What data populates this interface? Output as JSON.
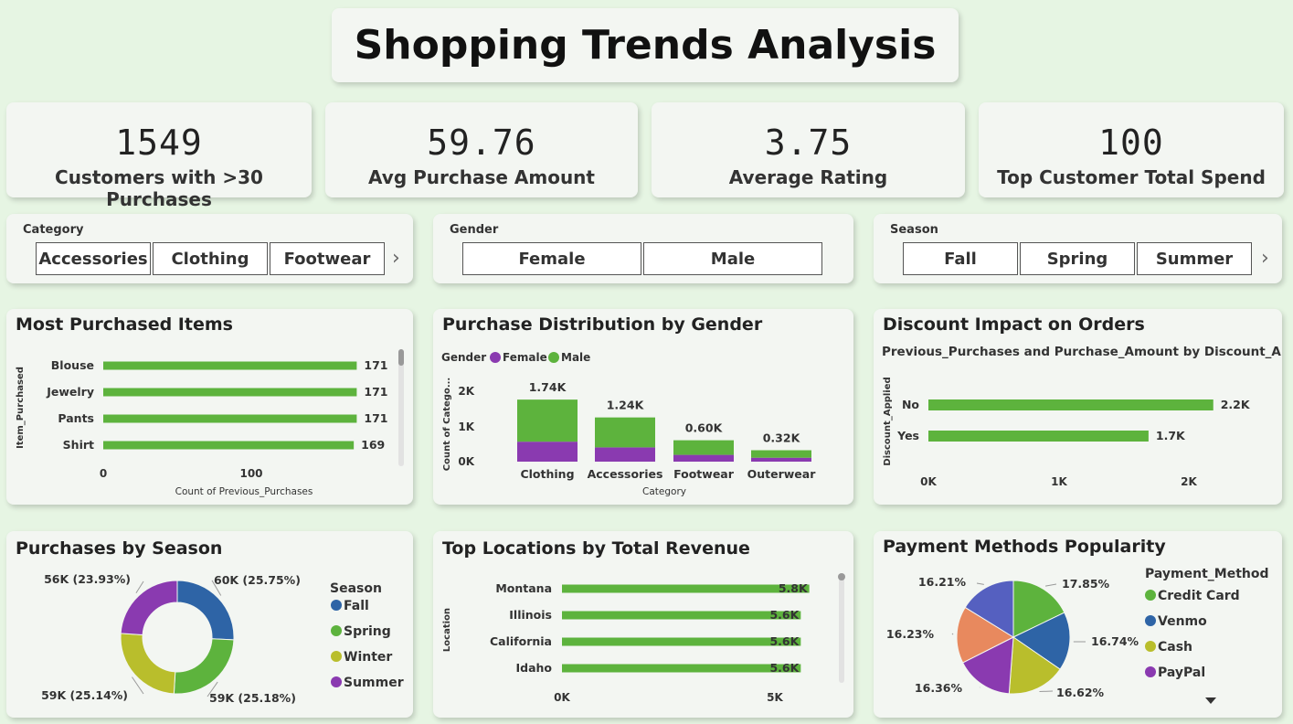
{
  "title": "Shopping Trends Analysis",
  "kpis": [
    {
      "value": "1549",
      "label": "Customers with >30 Purchases"
    },
    {
      "value": "59.76",
      "label": "Avg Purchase Amount"
    },
    {
      "value": "3.75",
      "label": "Average Rating"
    },
    {
      "value": "100",
      "label": "Top Customer Total Spend"
    }
  ],
  "slicers": {
    "category": {
      "title": "Category",
      "options": [
        "Accessories",
        "Clothing",
        "Footwear"
      ]
    },
    "gender": {
      "title": "Gender",
      "options": [
        "Female",
        "Male"
      ]
    },
    "season": {
      "title": "Season",
      "options": [
        "Fall",
        "Spring",
        "Summer"
      ]
    }
  },
  "colors": {
    "green": "#5db33d",
    "purple": "#8a3ab0",
    "blue": "#2e64a6",
    "olive": "#b9be2c",
    "slate": "#5560c0",
    "orange": "#e8895e",
    "background": "#e6f5e3"
  },
  "most_purchased": {
    "title": "Most Purchased Items",
    "ylabel": "Item_Purchased",
    "xlabel": "Count of Previous_Purchases",
    "xticks": [
      "0",
      "100"
    ]
  },
  "gender_dist": {
    "title": "Purchase Distribution by Gender",
    "legend_title": "Gender",
    "ylabel": "Count of Catego...",
    "xlabel": "Category",
    "yticks": [
      "2K",
      "1K",
      "0K"
    ]
  },
  "discount": {
    "title": "Discount Impact on Orders",
    "subtitle": "Previous_Purchases  and Purchase_Amount by Discount_Ap...",
    "ylabel": "Discount_Applied",
    "xticks": [
      "0K",
      "1K",
      "2K"
    ]
  },
  "season_chart": {
    "title": "Purchases by Season",
    "legend_title": "Season"
  },
  "locations": {
    "title": "Top Locations by Total Revenue",
    "ylabel": "Location",
    "xticks": [
      "0K",
      "5K"
    ]
  },
  "payment": {
    "title": "Payment Methods Popularity",
    "legend_title": "Payment_Method"
  },
  "chart_data": [
    {
      "type": "bar",
      "id": "most_purchased",
      "orientation": "horizontal",
      "categories": [
        "Blouse",
        "Jewelry",
        "Pants",
        "Shirt"
      ],
      "values": [
        171,
        171,
        171,
        169
      ],
      "labels": [
        "171",
        "171",
        "171",
        "169"
      ],
      "xlim": [
        0,
        180
      ],
      "color": "#5db33d"
    },
    {
      "type": "bar",
      "id": "gender_dist",
      "stacked": true,
      "categories": [
        "Clothing",
        "Accessories",
        "Footwear",
        "Outerwear"
      ],
      "totals_labels": [
        "1.74K",
        "1.24K",
        "0.60K",
        "0.32K"
      ],
      "series": [
        {
          "name": "Female",
          "color": "#8a3ab0",
          "values": [
            560,
            400,
            190,
            110
          ]
        },
        {
          "name": "Male",
          "color": "#5db33d",
          "values": [
            1180,
            840,
            410,
            210
          ]
        }
      ],
      "ylim": [
        0,
        2300
      ]
    },
    {
      "type": "bar",
      "id": "discount",
      "orientation": "horizontal",
      "categories": [
        "No",
        "Yes"
      ],
      "values": [
        2200,
        1700
      ],
      "labels": [
        "2.2K",
        "1.7K"
      ],
      "xlim": [
        0,
        2350
      ],
      "color": "#5db33d"
    },
    {
      "type": "pie",
      "id": "season",
      "donut": true,
      "slices": [
        {
          "name": "Fall",
          "value": 25.75,
          "label": "60K (25.75%)",
          "color": "#2e64a6"
        },
        {
          "name": "Spring",
          "value": 25.18,
          "label": "59K (25.18%)",
          "color": "#5db33d"
        },
        {
          "name": "Winter",
          "value": 25.14,
          "label": "59K (25.14%)",
          "color": "#b9be2c"
        },
        {
          "name": "Summer",
          "value": 23.93,
          "label": "56K (23.93%)",
          "color": "#8a3ab0"
        }
      ]
    },
    {
      "type": "bar",
      "id": "locations",
      "orientation": "horizontal",
      "categories": [
        "Montana",
        "Illinois",
        "California",
        "Idaho"
      ],
      "values": [
        5800,
        5600,
        5600,
        5600
      ],
      "labels": [
        "5.8K",
        "5.6K",
        "5.6K",
        "5.6K"
      ],
      "xlim": [
        0,
        6000
      ],
      "color": "#5db33d"
    },
    {
      "type": "pie",
      "id": "payment",
      "slices": [
        {
          "name": "Credit Card",
          "value": 17.85,
          "label": "17.85%",
          "color": "#5db33d"
        },
        {
          "name": "Venmo",
          "value": 16.74,
          "label": "16.74%",
          "color": "#2e64a6"
        },
        {
          "name": "Cash",
          "value": 16.62,
          "label": "16.62%",
          "color": "#b9be2c"
        },
        {
          "name": "PayPal",
          "value": 16.36,
          "label": "16.36%",
          "color": "#8a3ab0"
        },
        {
          "name": "",
          "value": 16.23,
          "label": "16.23%",
          "color": "#e8895e"
        },
        {
          "name": "",
          "value": 16.21,
          "label": "16.21%",
          "color": "#5560c0"
        }
      ],
      "legend_visible": [
        "Credit Card",
        "Venmo",
        "Cash",
        "PayPal"
      ]
    }
  ]
}
